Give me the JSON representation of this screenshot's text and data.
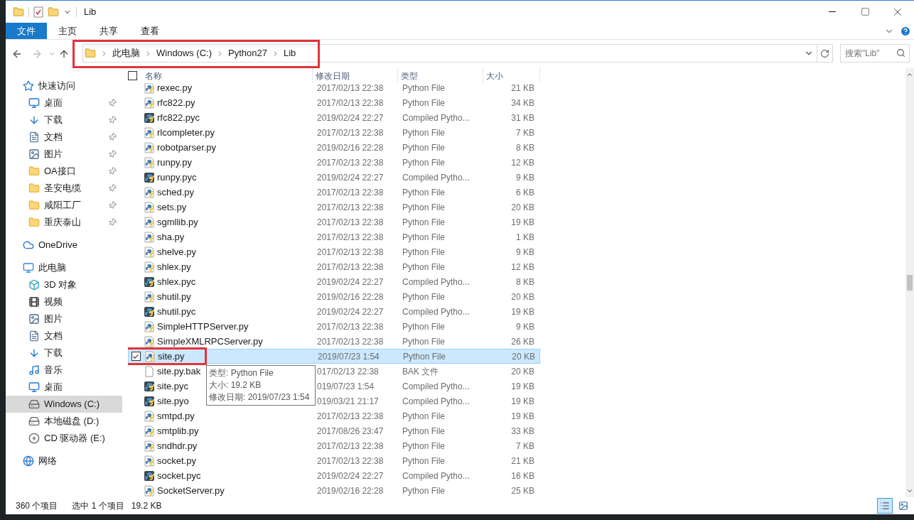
{
  "window": {
    "title": "Lib"
  },
  "ribbon_tabs": [
    {
      "label": "文件",
      "selected": true
    },
    {
      "label": "主页",
      "selected": false
    },
    {
      "label": "共享",
      "selected": false
    },
    {
      "label": "查看",
      "selected": false
    }
  ],
  "address_bar": {
    "highlighted": true,
    "crumbs": [
      "此电脑",
      "Windows (C:)",
      "Python27",
      "Lib"
    ]
  },
  "search": {
    "placeholder": "搜索\"Lib\""
  },
  "sidebar": {
    "items": [
      {
        "label": "快速访问",
        "kind": "star",
        "selected": false,
        "children": [
          {
            "label": "桌面",
            "kind": "desktop",
            "pinned": true,
            "selected": false
          },
          {
            "label": "下载",
            "kind": "download",
            "pinned": true,
            "selected": false
          },
          {
            "label": "文档",
            "kind": "document",
            "pinned": true,
            "selected": false
          },
          {
            "label": "图片",
            "kind": "pictures",
            "pinned": true,
            "selected": false
          },
          {
            "label": "OA接口",
            "kind": "folder",
            "pinned": true,
            "selected": false
          },
          {
            "label": "圣安电缆",
            "kind": "folder",
            "pinned": true,
            "selected": false
          },
          {
            "label": "咸阳工厂",
            "kind": "folder",
            "pinned": true,
            "selected": false
          },
          {
            "label": "重庆泰山",
            "kind": "folder",
            "pinned": true,
            "selected": false
          }
        ]
      },
      {
        "label": "OneDrive",
        "kind": "cloud",
        "selected": false
      },
      {
        "label": "此电脑",
        "kind": "pc",
        "selected": false,
        "children": [
          {
            "label": "3D 对象",
            "kind": "cube",
            "pinned": false,
            "selected": false
          },
          {
            "label": "视频",
            "kind": "video",
            "pinned": false,
            "selected": false
          },
          {
            "label": "图片",
            "kind": "pictures",
            "pinned": false,
            "selected": false
          },
          {
            "label": "文档",
            "kind": "document",
            "pinned": false,
            "selected": false
          },
          {
            "label": "下载",
            "kind": "download",
            "pinned": false,
            "selected": false
          },
          {
            "label": "音乐",
            "kind": "music",
            "pinned": false,
            "selected": false
          },
          {
            "label": "桌面",
            "kind": "desktop",
            "pinned": false,
            "selected": false
          },
          {
            "label": "Windows (C:)",
            "kind": "drive",
            "pinned": false,
            "selected": true
          },
          {
            "label": "本地磁盘 (D:)",
            "kind": "drive",
            "pinned": false,
            "selected": false
          },
          {
            "label": "CD 驱动器 (E:)",
            "kind": "cd",
            "pinned": false,
            "selected": false
          }
        ]
      },
      {
        "label": "网络",
        "kind": "network",
        "selected": false
      }
    ]
  },
  "table": {
    "all_selected": false,
    "columns": [
      "名称",
      "修改日期",
      "类型",
      "大小"
    ],
    "rows": [
      {
        "name": "rexec.py",
        "kind": "py",
        "date": "2017/02/13 22:38",
        "type": "Python File",
        "size": "21 KB",
        "selected": false
      },
      {
        "name": "rfc822.py",
        "kind": "py",
        "date": "2017/02/13 22:38",
        "type": "Python File",
        "size": "34 KB",
        "selected": false
      },
      {
        "name": "rfc822.pyc",
        "kind": "pyc",
        "date": "2019/02/24 22:27",
        "type": "Compiled Pytho...",
        "size": "31 KB",
        "selected": false
      },
      {
        "name": "rlcompleter.py",
        "kind": "py",
        "date": "2017/02/13 22:38",
        "type": "Python File",
        "size": "7 KB",
        "selected": false
      },
      {
        "name": "robotparser.py",
        "kind": "py",
        "date": "2019/02/16 22:28",
        "type": "Python File",
        "size": "8 KB",
        "selected": false
      },
      {
        "name": "runpy.py",
        "kind": "py",
        "date": "2017/02/13 22:38",
        "type": "Python File",
        "size": "12 KB",
        "selected": false
      },
      {
        "name": "runpy.pyc",
        "kind": "pyc",
        "date": "2019/02/24 22:27",
        "type": "Compiled Pytho...",
        "size": "9 KB",
        "selected": false
      },
      {
        "name": "sched.py",
        "kind": "py",
        "date": "2017/02/13 22:38",
        "type": "Python File",
        "size": "6 KB",
        "selected": false
      },
      {
        "name": "sets.py",
        "kind": "py",
        "date": "2017/02/13 22:38",
        "type": "Python File",
        "size": "20 KB",
        "selected": false
      },
      {
        "name": "sgmllib.py",
        "kind": "py",
        "date": "2017/02/13 22:38",
        "type": "Python File",
        "size": "19 KB",
        "selected": false
      },
      {
        "name": "sha.py",
        "kind": "py",
        "date": "2017/02/13 22:38",
        "type": "Python File",
        "size": "1 KB",
        "selected": false
      },
      {
        "name": "shelve.py",
        "kind": "py",
        "date": "2017/02/13 22:38",
        "type": "Python File",
        "size": "9 KB",
        "selected": false
      },
      {
        "name": "shlex.py",
        "kind": "py",
        "date": "2017/02/13 22:38",
        "type": "Python File",
        "size": "12 KB",
        "selected": false
      },
      {
        "name": "shlex.pyc",
        "kind": "pyc",
        "date": "2019/02/24 22:27",
        "type": "Compiled Pytho...",
        "size": "8 KB",
        "selected": false
      },
      {
        "name": "shutil.py",
        "kind": "py",
        "date": "2019/02/16 22:28",
        "type": "Python File",
        "size": "20 KB",
        "selected": false
      },
      {
        "name": "shutil.pyc",
        "kind": "pyc",
        "date": "2019/02/24 22:27",
        "type": "Compiled Pytho...",
        "size": "19 KB",
        "selected": false
      },
      {
        "name": "SimpleHTTPServer.py",
        "kind": "py",
        "date": "2017/02/13 22:38",
        "type": "Python File",
        "size": "9 KB",
        "selected": false
      },
      {
        "name": "SimpleXMLRPCServer.py",
        "kind": "py",
        "date": "2017/02/13 22:38",
        "type": "Python File",
        "size": "26 KB",
        "selected": false
      },
      {
        "name": "site.py",
        "kind": "py",
        "date": "2019/07/23 1:54",
        "type": "Python File",
        "size": "20 KB",
        "selected": true,
        "highlighted": true
      },
      {
        "name": "site.py.bak",
        "kind": "bak",
        "date": "017/02/13 22:38",
        "type": "BAK 文件",
        "size": "20 KB",
        "selected": false
      },
      {
        "name": "site.pyc",
        "kind": "pyc",
        "date": "019/07/23 1:54",
        "type": "Compiled Pytho...",
        "size": "19 KB",
        "selected": false
      },
      {
        "name": "site.pyo",
        "kind": "pyc",
        "date": "019/03/21 21:17",
        "type": "Compiled Pytho...",
        "size": "19 KB",
        "selected": false
      },
      {
        "name": "smtpd.py",
        "kind": "py",
        "date": "2017/02/13 22:38",
        "type": "Python File",
        "size": "19 KB",
        "selected": false
      },
      {
        "name": "smtplib.py",
        "kind": "py",
        "date": "2017/08/26 23:47",
        "type": "Python File",
        "size": "33 KB",
        "selected": false
      },
      {
        "name": "sndhdr.py",
        "kind": "py",
        "date": "2017/02/13 22:38",
        "type": "Python File",
        "size": "7 KB",
        "selected": false
      },
      {
        "name": "socket.py",
        "kind": "py",
        "date": "2017/02/13 22:38",
        "type": "Python File",
        "size": "21 KB",
        "selected": false
      },
      {
        "name": "socket.pyc",
        "kind": "pyc",
        "date": "2019/02/24 22:27",
        "type": "Compiled Pytho...",
        "size": "16 KB",
        "selected": false
      },
      {
        "name": "SocketServer.py",
        "kind": "py",
        "date": "2019/02/16 22:28",
        "type": "Python File",
        "size": "25 KB",
        "selected": false
      }
    ]
  },
  "tooltip": {
    "lines": [
      "类型: Python File",
      "大小: 19.2 KB",
      "修改日期: 2019/07/23 1:54"
    ]
  },
  "status_bar": {
    "count": "360 个项目",
    "selection": "选中 1 个项目",
    "size": "19.2 KB"
  },
  "view_buttons": [
    {
      "kind": "details",
      "selected": true
    },
    {
      "kind": "large_icons",
      "selected": false
    }
  ]
}
